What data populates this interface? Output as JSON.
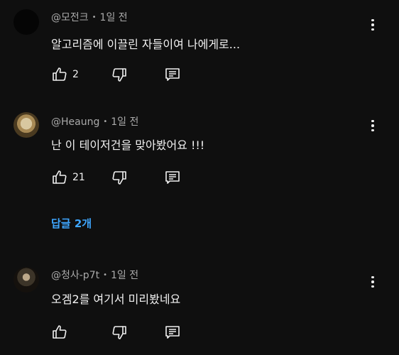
{
  "comments": [
    {
      "author": "@모전크",
      "time": "1일 전",
      "text": "알고리즘에 이끌린 자들이여 나에게로...",
      "likes": "2"
    },
    {
      "author": "@Heaung",
      "time": "1일 전",
      "text": "난 이 테이저건을 맞아봤어요 !!!",
      "likes": "21",
      "replies": "답글 2개"
    },
    {
      "author": "@청사-p7t",
      "time": "1일 전",
      "text": "오겜2를 여기서 미리봤네요",
      "likes": ""
    }
  ],
  "separator": "•",
  "icons": {
    "like": "thumbs-up-icon",
    "dislike": "thumbs-down-icon",
    "reply": "reply-icon",
    "more": "more-vert-icon"
  },
  "colors": {
    "background": "#0f0f0f",
    "text": "#f1f1f1",
    "meta": "#aaaaaa",
    "link": "#3ea6ff"
  }
}
